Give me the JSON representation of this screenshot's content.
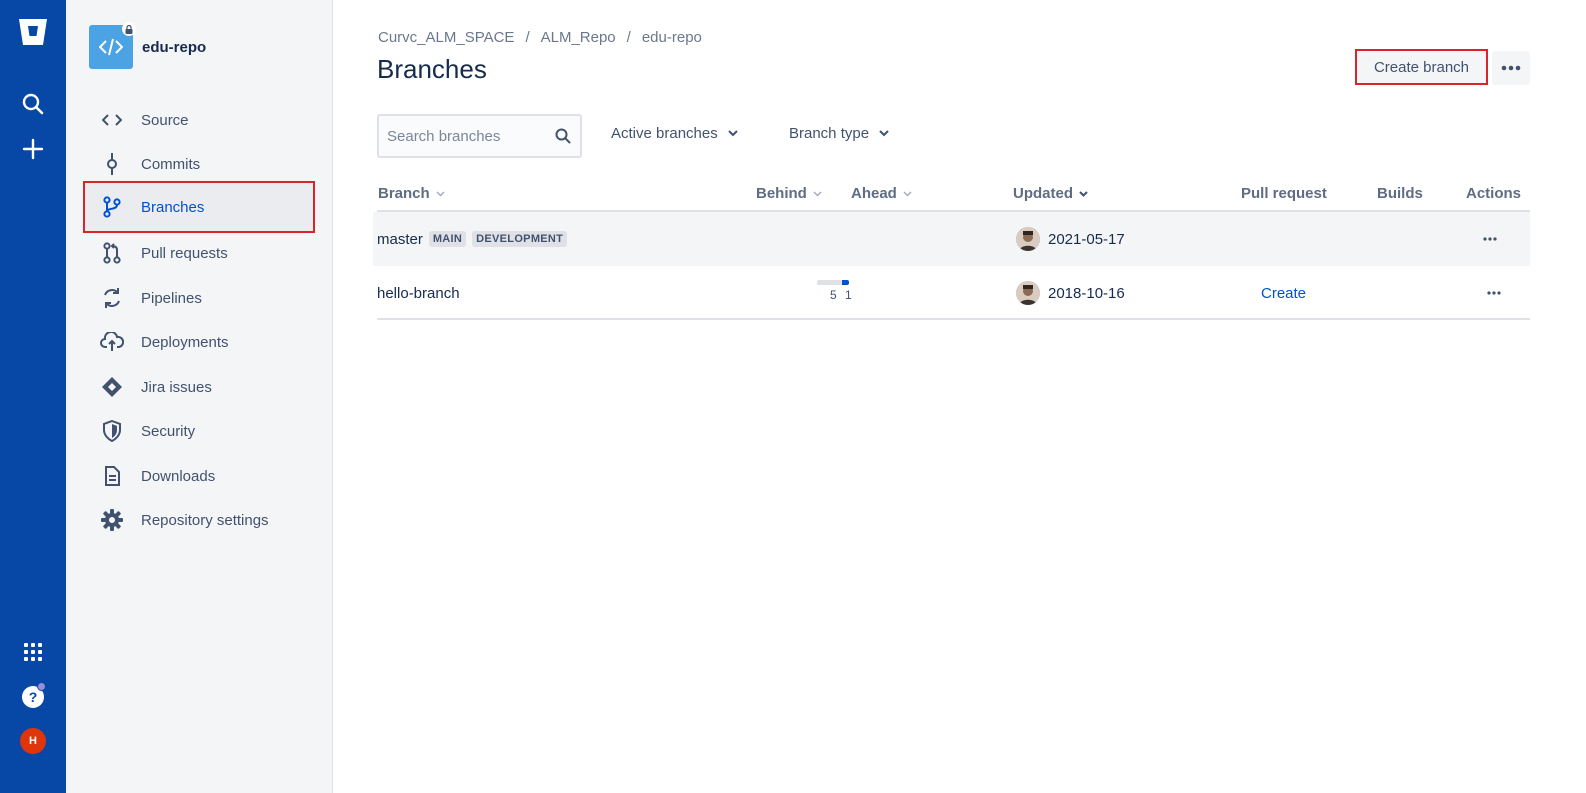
{
  "global_nav": {
    "logo": "bitbucket-logo-icon",
    "search_icon": "search-icon",
    "create_icon": "plus-icon",
    "apps_icon": "app-switcher-icon",
    "help_icon": "help-icon",
    "user_initial": "H"
  },
  "sidebar": {
    "repo_name": "edu-repo",
    "items": [
      {
        "label": "Source",
        "icon": "code-icon"
      },
      {
        "label": "Commits",
        "icon": "commit-icon"
      },
      {
        "label": "Branches",
        "icon": "branch-icon",
        "active": true
      },
      {
        "label": "Pull requests",
        "icon": "pull-request-icon"
      },
      {
        "label": "Pipelines",
        "icon": "pipelines-icon"
      },
      {
        "label": "Deployments",
        "icon": "deployments-icon"
      },
      {
        "label": "Jira issues",
        "icon": "jira-icon"
      },
      {
        "label": "Security",
        "icon": "shield-icon"
      },
      {
        "label": "Downloads",
        "icon": "file-icon"
      },
      {
        "label": "Repository settings",
        "icon": "gear-icon"
      }
    ]
  },
  "breadcrumbs": [
    "Curvc_ALM_SPACE",
    "ALM_Repo",
    "edu-repo"
  ],
  "page_title": "Branches",
  "actions": {
    "create_branch": "Create branch"
  },
  "filters": {
    "search_placeholder": "Search branches",
    "active_branches": "Active branches",
    "branch_type": "Branch type"
  },
  "table": {
    "columns": [
      "Branch",
      "Behind",
      "Ahead",
      "Updated",
      "Pull request",
      "Builds",
      "Actions"
    ],
    "rows": [
      {
        "branch": "master",
        "labels": [
          "MAIN",
          "DEVELOPMENT"
        ],
        "behind": "",
        "ahead": "",
        "updated": "2021-05-17",
        "pull_request": "",
        "builds": ""
      },
      {
        "branch": "hello-branch",
        "labels": [],
        "behind": "5",
        "ahead": "1",
        "updated": "2018-10-16",
        "pull_request": "Create",
        "builds": ""
      }
    ]
  },
  "colors": {
    "global_nav": "#0747A6",
    "accent": "#0052CC",
    "highlight_border": "#D9242A"
  }
}
